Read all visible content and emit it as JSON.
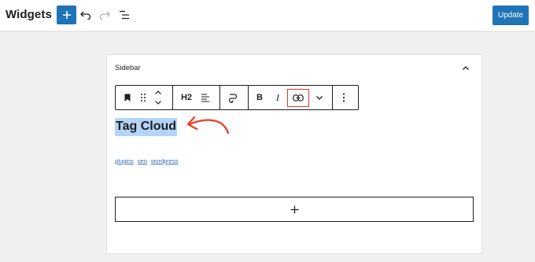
{
  "header": {
    "title": "Widgets",
    "update_label": "Update",
    "accent_color": "#1f73b7"
  },
  "sidebar_panel": {
    "title": "Sidebar"
  },
  "block_toolbar": {
    "heading_level": "H2",
    "bold": "B",
    "italic": "I"
  },
  "block": {
    "heading": "Tag Cloud",
    "tags": [
      "plugins",
      "seo",
      "wordpress"
    ]
  },
  "icons": [
    "plus-icon",
    "undo-icon",
    "redo-icon",
    "list-view-icon",
    "bookmark-icon",
    "drag-handle-icon",
    "move-up-icon",
    "move-down-icon",
    "align-icon",
    "transform-icon",
    "link-icon",
    "chevron-down-icon",
    "more-options-icon",
    "chevron-up-icon"
  ],
  "highlight_color": "#d93a2b"
}
